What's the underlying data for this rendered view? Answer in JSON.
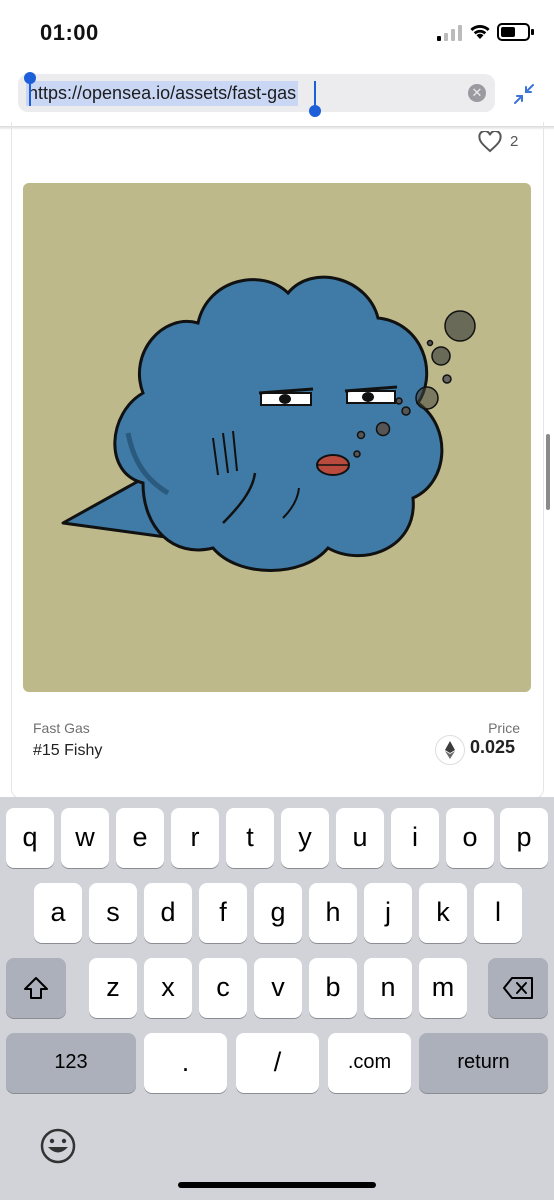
{
  "status_bar": {
    "time": "01:00"
  },
  "browser": {
    "url": "https://opensea.io/assets/fast-gas",
    "clear_icon": "x-circle-icon",
    "collapse_icon": "collapse-arrows-icon"
  },
  "asset": {
    "likes": "2",
    "collection": "Fast Gas",
    "name": "#15 Fishy",
    "price_label": "Price",
    "price": "0.025",
    "currency_icon": "ethereum-icon"
  },
  "keyboard": {
    "row1": [
      "q",
      "w",
      "e",
      "r",
      "t",
      "y",
      "u",
      "i",
      "o",
      "p"
    ],
    "row2": [
      "a",
      "s",
      "d",
      "f",
      "g",
      "h",
      "j",
      "k",
      "l"
    ],
    "row3": [
      "z",
      "x",
      "c",
      "v",
      "b",
      "n",
      "m"
    ],
    "bottom": {
      "numbers": "123",
      "dot": ".",
      "slash": "/",
      "dotcom": ".com",
      "return": "return"
    }
  },
  "colors": {
    "art_background": "#bdb98a",
    "creature": "#3f7ba6",
    "selection": "#c9d7f5",
    "cursor": "#1d5fd8"
  }
}
